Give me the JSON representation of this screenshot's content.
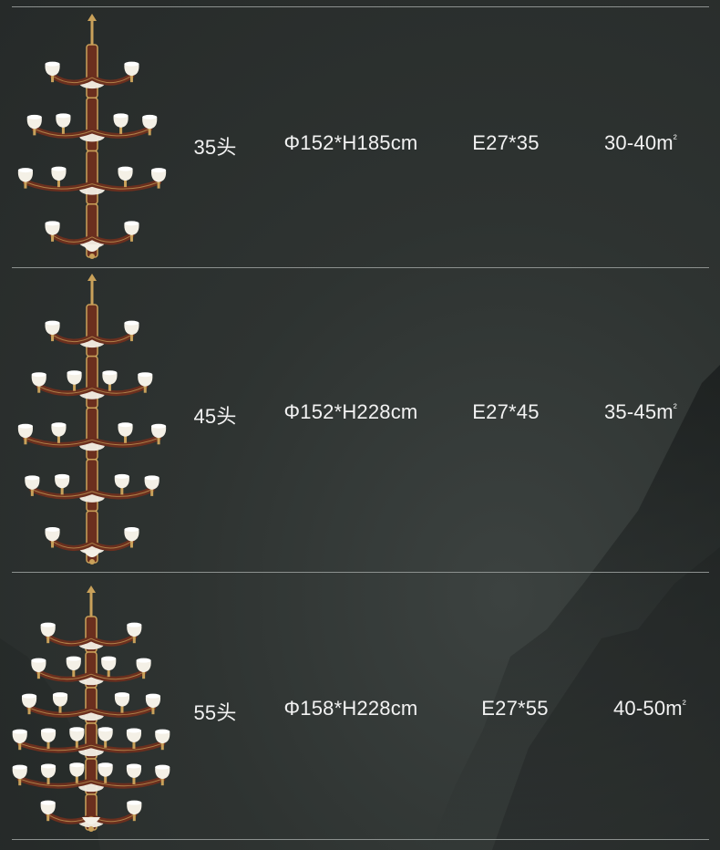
{
  "rows": [
    {
      "heads": "35头",
      "size": "Φ152*H185cm",
      "bulb": "E27*35",
      "area_base": "30-40m",
      "area_unit": "²",
      "tiers": 4
    },
    {
      "heads": "45头",
      "size": "Φ152*H228cm",
      "bulb": "E27*45",
      "area_base": "35-45m",
      "area_unit": "²",
      "tiers": 5
    },
    {
      "heads": "55头",
      "size": "Φ158*H228cm",
      "bulb": "E27*55",
      "area_base": "40-50m",
      "area_unit": "²",
      "tiers": 6
    }
  ],
  "colors": {
    "background": "#2e3331",
    "divider": "#8c918f",
    "text": "#f2f2f2",
    "wood": "#6b2f1e",
    "brass": "#c9a15a",
    "glass": "#f4f0e6"
  }
}
